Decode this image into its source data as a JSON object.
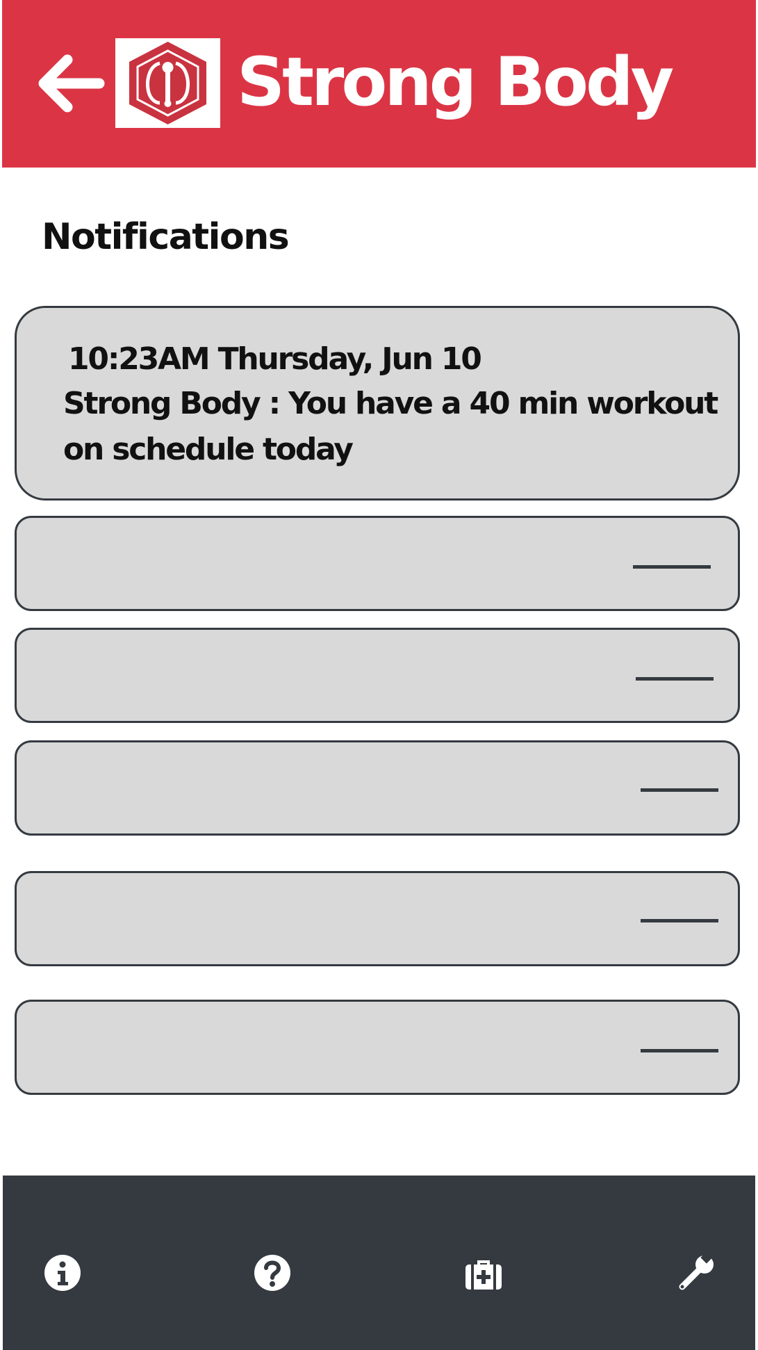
{
  "header": {
    "app_title": "Strong Body",
    "background_color": "#db3545",
    "back_icon": "arrow-left-icon",
    "logo_icon": "strong-body-logo"
  },
  "page": {
    "title": "Notifications"
  },
  "notifications": [
    {
      "time": "10:23AM Thursday, Jun 10",
      "message": "Strong Body : You have a 40 min workout on schedule today"
    }
  ],
  "empty_notification_count": 5,
  "bottom_nav": {
    "background_color": "#343a40",
    "items": [
      {
        "icon": "info-icon"
      },
      {
        "icon": "help-icon"
      },
      {
        "icon": "first-aid-kit-icon"
      },
      {
        "icon": "wrench-icon"
      }
    ]
  }
}
